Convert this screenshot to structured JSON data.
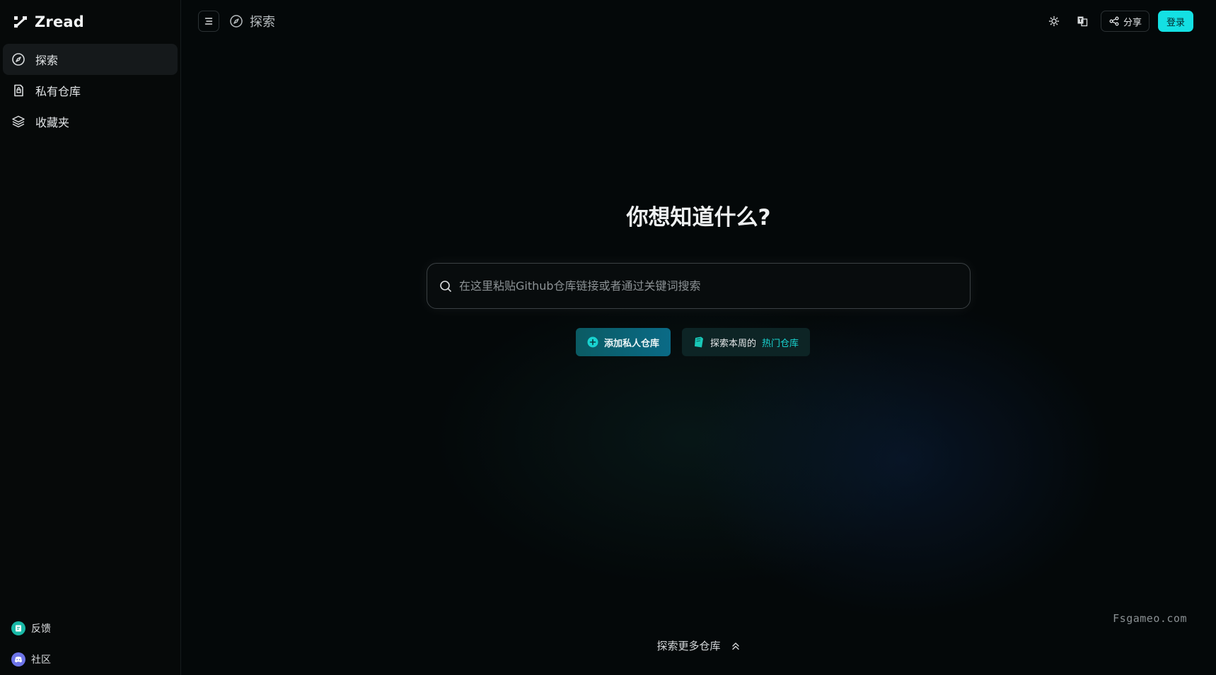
{
  "app": {
    "brand_name": "Zread",
    "accent_color": "#14e0e3"
  },
  "sidebar": {
    "items": [
      {
        "label": "探索",
        "icon": "compass-icon",
        "active": true
      },
      {
        "label": "私有仓库",
        "icon": "private-repo-icon",
        "active": false
      },
      {
        "label": "收藏夹",
        "icon": "layers-icon",
        "active": false
      }
    ],
    "bottom": [
      {
        "label": "反馈",
        "icon": "feedback-icon"
      },
      {
        "label": "社区",
        "icon": "discord-icon"
      }
    ]
  },
  "topbar": {
    "breadcrumb": "探索",
    "share_label": "分享",
    "login_label": "登录"
  },
  "hero": {
    "title": "你想知道什么?",
    "search_placeholder": "在这里粘贴Github仓库链接或者通过关键词搜索",
    "add_private_label": "添加私人仓库",
    "explore_prefix": "探索本周的",
    "explore_highlight": "热门仓库"
  },
  "footer": {
    "more_repos": "探索更多仓库",
    "watermark": "Fsgameo.com"
  }
}
